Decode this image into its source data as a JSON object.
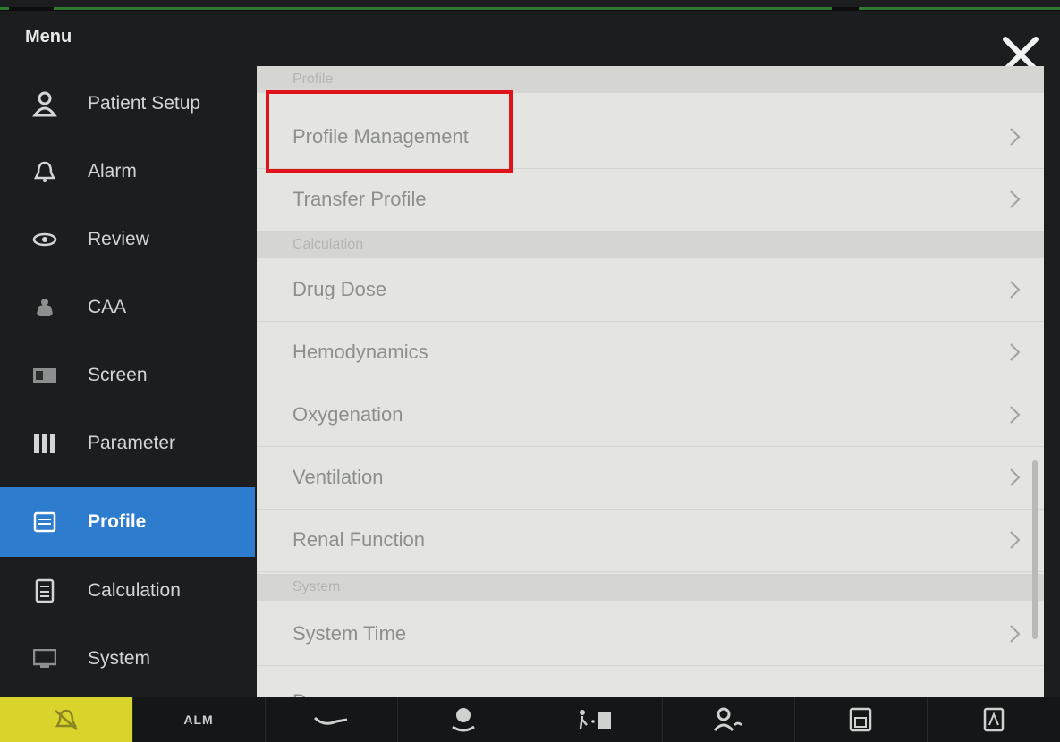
{
  "menu": {
    "title": "Menu"
  },
  "sidebar": {
    "items": [
      {
        "label": "Patient Setup",
        "icon": "person-icon"
      },
      {
        "label": "Alarm",
        "icon": "bell-icon"
      },
      {
        "label": "Review",
        "icon": "review-icon"
      },
      {
        "label": "CAA",
        "icon": "caa-icon"
      },
      {
        "label": "Screen",
        "icon": "screen-icon"
      },
      {
        "label": "Parameter",
        "icon": "parameter-icon"
      },
      {
        "label": "Profile",
        "icon": "profile-icon",
        "active": true
      },
      {
        "label": "Calculation",
        "icon": "calculator-icon"
      },
      {
        "label": "System",
        "icon": "system-icon"
      }
    ]
  },
  "panel": {
    "profile_header": "Profile",
    "profile_management": "Profile Management",
    "transfer_profile": "Transfer Profile",
    "calculation_header": "Calculation",
    "drug_dose": "Drug Dose",
    "hemodynamics": "Hemodynamics",
    "oxygenation": "Oxygenation",
    "ventilation": "Ventilation",
    "renal_function": "Renal Function",
    "system_header": "System",
    "system_time": "System Time",
    "partial_item": "Demo"
  },
  "bottombar": {
    "items": [
      {
        "icon": "alarm-silence-icon",
        "active": true
      },
      {
        "icon": "alarm-pause-icon",
        "label": "ALM"
      },
      {
        "icon": "nibp-icon"
      },
      {
        "icon": "cardiac-icon"
      },
      {
        "icon": "patient-transfer-icon"
      },
      {
        "icon": "patient-setup-icon"
      },
      {
        "icon": "save-icon"
      },
      {
        "icon": "print-icon"
      }
    ]
  },
  "colors": {
    "active_blue": "#2d7ccd",
    "highlight_red": "#e0131d",
    "active_yellow": "#d8d42c",
    "panel_bg": "#e4e5e1"
  }
}
